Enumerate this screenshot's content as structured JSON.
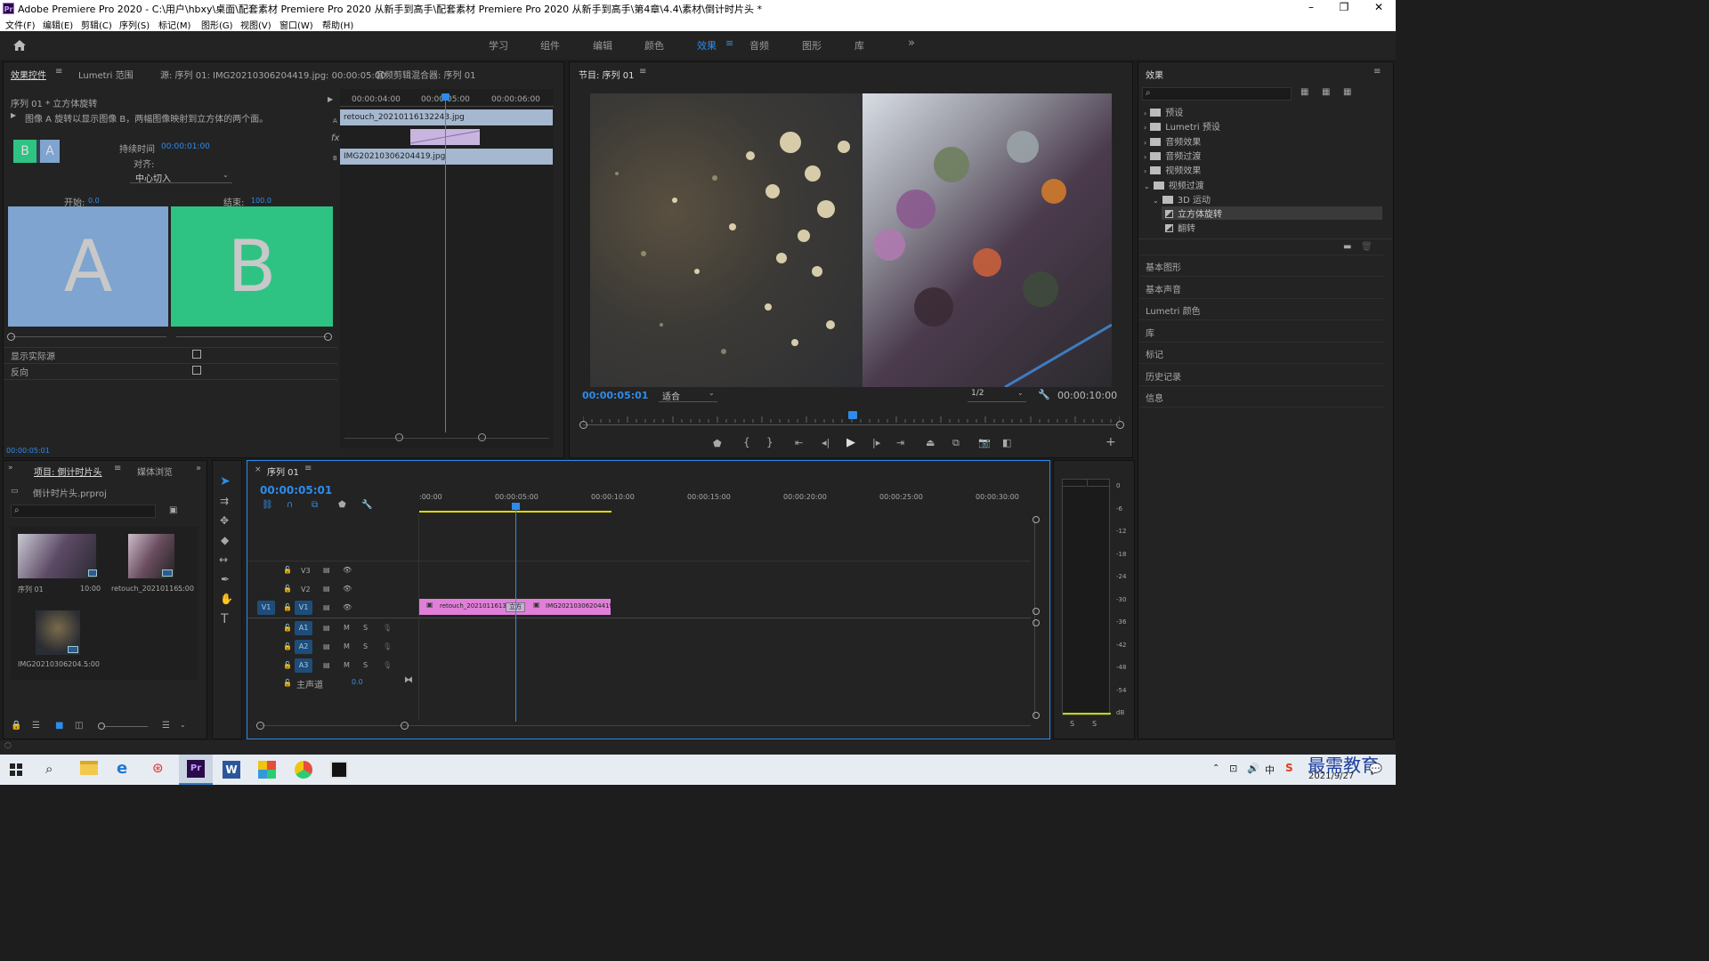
{
  "window": {
    "app_logo": "Pr",
    "title": "Adobe Premiere Pro 2020 - C:\\用户\\hbxy\\桌面\\配套素材 Premiere Pro 2020 从新手到高手\\配套素材 Premiere Pro 2020 从新手到高手\\第4章\\4.4\\素材\\倒计时片头 *",
    "minimize": "–",
    "restore": "❐",
    "close": "✕"
  },
  "menu": [
    "文件(F)",
    "编辑(E)",
    "剪辑(C)",
    "序列(S)",
    "标记(M)",
    "图形(G)",
    "视图(V)",
    "窗口(W)",
    "帮助(H)"
  ],
  "workspaces": {
    "items": [
      "学习",
      "组件",
      "编辑",
      "颜色",
      "效果",
      "音频",
      "图形",
      "库"
    ],
    "active": "效果",
    "more": "»"
  },
  "effect_controls": {
    "tabs": [
      "效果控件",
      "Lumetri 范围",
      "源: 序列 01: IMG20210306204419.jpg: 00:00:05:00",
      "音频剪辑混合器: 序列 01"
    ],
    "sequence_clip": "序列 01 * 立方体旋转",
    "description": "图像 A 旋转以显示图像 B，两幅图像映射到立方体的两个面。",
    "duration_label": "持续时间",
    "duration_value": "00:00:01:00",
    "align_label": "对齐:",
    "align_value": "中心切入",
    "start_label": "开始:",
    "start_value": "0.0",
    "end_label": "结束:",
    "end_value": "100.0",
    "thumb_a": "A",
    "thumb_b": "B",
    "show_actual_sources": "显示实际源",
    "reverse": "反向",
    "timecode": "00:00:05:01",
    "ruler": [
      "00:00:04:00",
      "00:00:05:00",
      "00:00:06:00"
    ],
    "clip_a": "retouch_20210116132243.jpg",
    "clip_b": "IMG20210306204419.jpg",
    "track_a": "A",
    "track_b": "B",
    "fx": "fx"
  },
  "program_monitor": {
    "title": "节目: 序列 01",
    "timecode": "00:00:05:01",
    "fit": "适合",
    "resolution": "1/2",
    "duration": "00:00:10:00",
    "playhead_fraction": 0.502
  },
  "effects_panel": {
    "title": "效果",
    "tree": [
      {
        "label": "预设",
        "open": false,
        "level": 0
      },
      {
        "label": "Lumetri 预设",
        "open": false,
        "level": 0
      },
      {
        "label": "音频效果",
        "open": false,
        "level": 0
      },
      {
        "label": "音频过渡",
        "open": false,
        "level": 0
      },
      {
        "label": "视频效果",
        "open": false,
        "level": 0
      },
      {
        "label": "视频过渡",
        "open": true,
        "level": 0
      },
      {
        "label": "3D 运动",
        "open": true,
        "level": 1
      },
      {
        "label": "立方体旋转",
        "open": false,
        "level": 2,
        "selected": true
      },
      {
        "label": "翻转",
        "open": false,
        "level": 2
      }
    ],
    "collapsed_panels": [
      "基本图形",
      "基本声音",
      "Lumetri 颜色",
      "库",
      "标记",
      "历史记录",
      "信息"
    ]
  },
  "project_panel": {
    "tabs": [
      "项目: 倒计时片头",
      "媒体浏览"
    ],
    "project_file": "倒计时片头.prproj",
    "items": [
      {
        "name": "序列 01",
        "duration": "10:00"
      },
      {
        "name": "retouch_20210116...",
        "duration": "5:00"
      },
      {
        "name": "IMG2021030620​4...",
        "duration": "5:00"
      }
    ]
  },
  "timeline": {
    "tab": "序列 01",
    "timecode": "00:00:05:01",
    "ruler": [
      ":00:00",
      "00:00:05:00",
      "00:00:10:00",
      "00:00:15:00",
      "00:00:20:00",
      "00:00:25:00",
      "00:00:30:00"
    ],
    "video_tracks": [
      "V3",
      "V2",
      "V1"
    ],
    "audio_tracks": [
      "A1",
      "A2",
      "A3"
    ],
    "source_patch_v": "V1",
    "master_label": "主声道",
    "master_value": "0.0",
    "clip1": "retouch_2021011613",
    "transition": "立方",
    "clip2": "IMG20210306204419",
    "mute": "M",
    "solo": "S"
  },
  "audio_meter": {
    "scale": [
      "0",
      "-6",
      "-12",
      "-18",
      "-24",
      "-30",
      "-36",
      "-42",
      "-48",
      "-54",
      "dB"
    ],
    "solo_l": "S",
    "solo_r": "S"
  },
  "taskbar": {
    "date": "2021/9/27",
    "watermark": "最需教育",
    "ime": "中",
    "colors": {
      "pr": "#2a0a48",
      "word": "#2b579a",
      "edge": "#1e7bd4"
    }
  }
}
